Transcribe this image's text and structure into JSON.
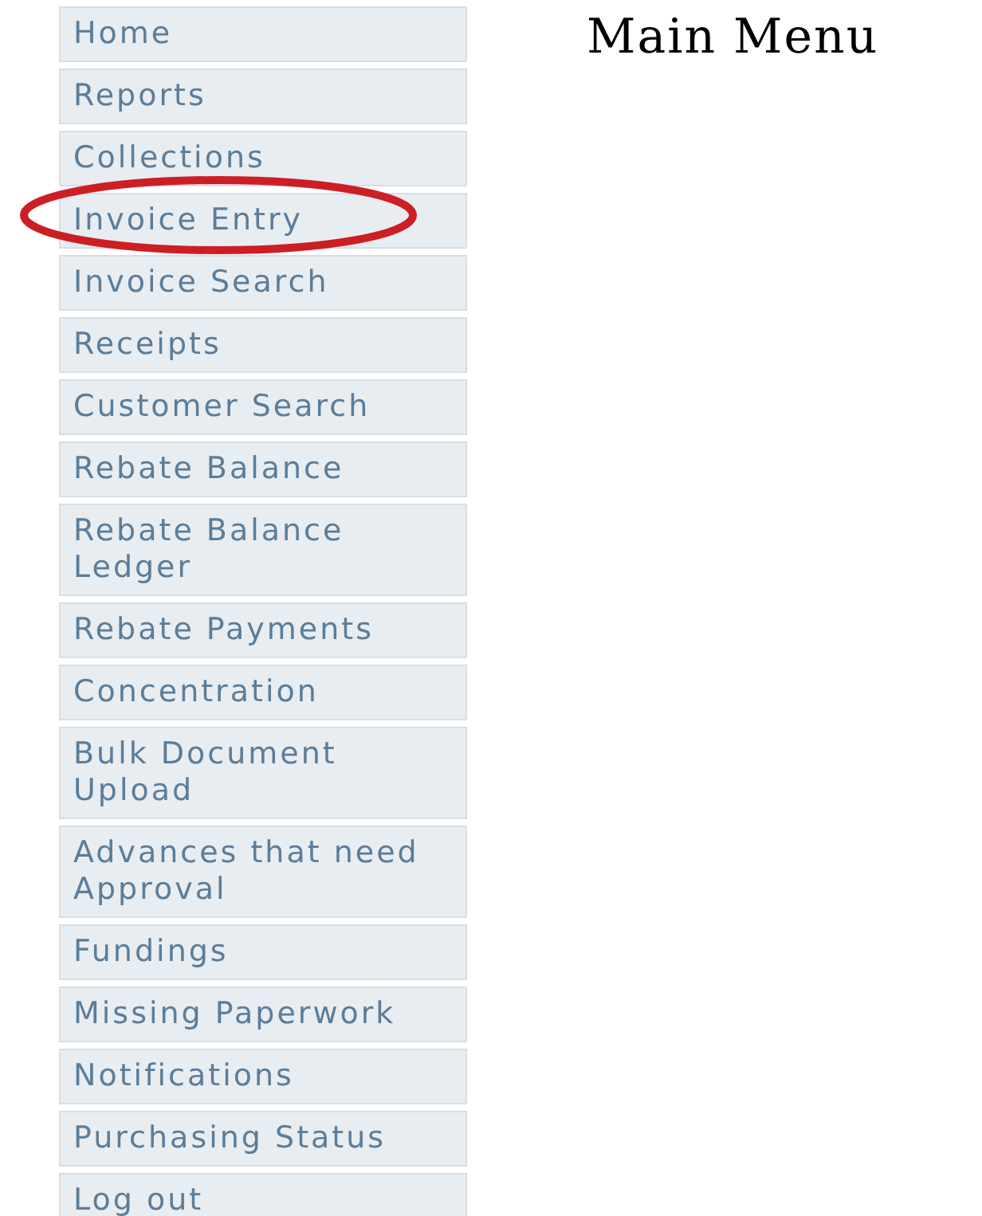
{
  "sidebar": {
    "items": [
      {
        "label": "Home",
        "circled": false
      },
      {
        "label": "Reports",
        "circled": false
      },
      {
        "label": "Collections",
        "circled": false
      },
      {
        "label": "Invoice Entry",
        "circled": true
      },
      {
        "label": "Invoice Search",
        "circled": false
      },
      {
        "label": "Receipts",
        "circled": false
      },
      {
        "label": "Customer Search",
        "circled": false
      },
      {
        "label": "Rebate Balance",
        "circled": false
      },
      {
        "label": "Rebate Balance Ledger",
        "circled": false
      },
      {
        "label": "Rebate Payments",
        "circled": false
      },
      {
        "label": "Concentration",
        "circled": false
      },
      {
        "label": "Bulk Document Upload",
        "circled": false
      },
      {
        "label": "Advances that need Approval",
        "circled": false
      },
      {
        "label": "Fundings",
        "circled": false
      },
      {
        "label": "Missing Paperwork",
        "circled": false
      },
      {
        "label": "Notifications",
        "circled": false
      },
      {
        "label": "Purchasing Status",
        "circled": false
      },
      {
        "label": "Log out",
        "circled": false
      }
    ]
  },
  "title": "Main Menu"
}
